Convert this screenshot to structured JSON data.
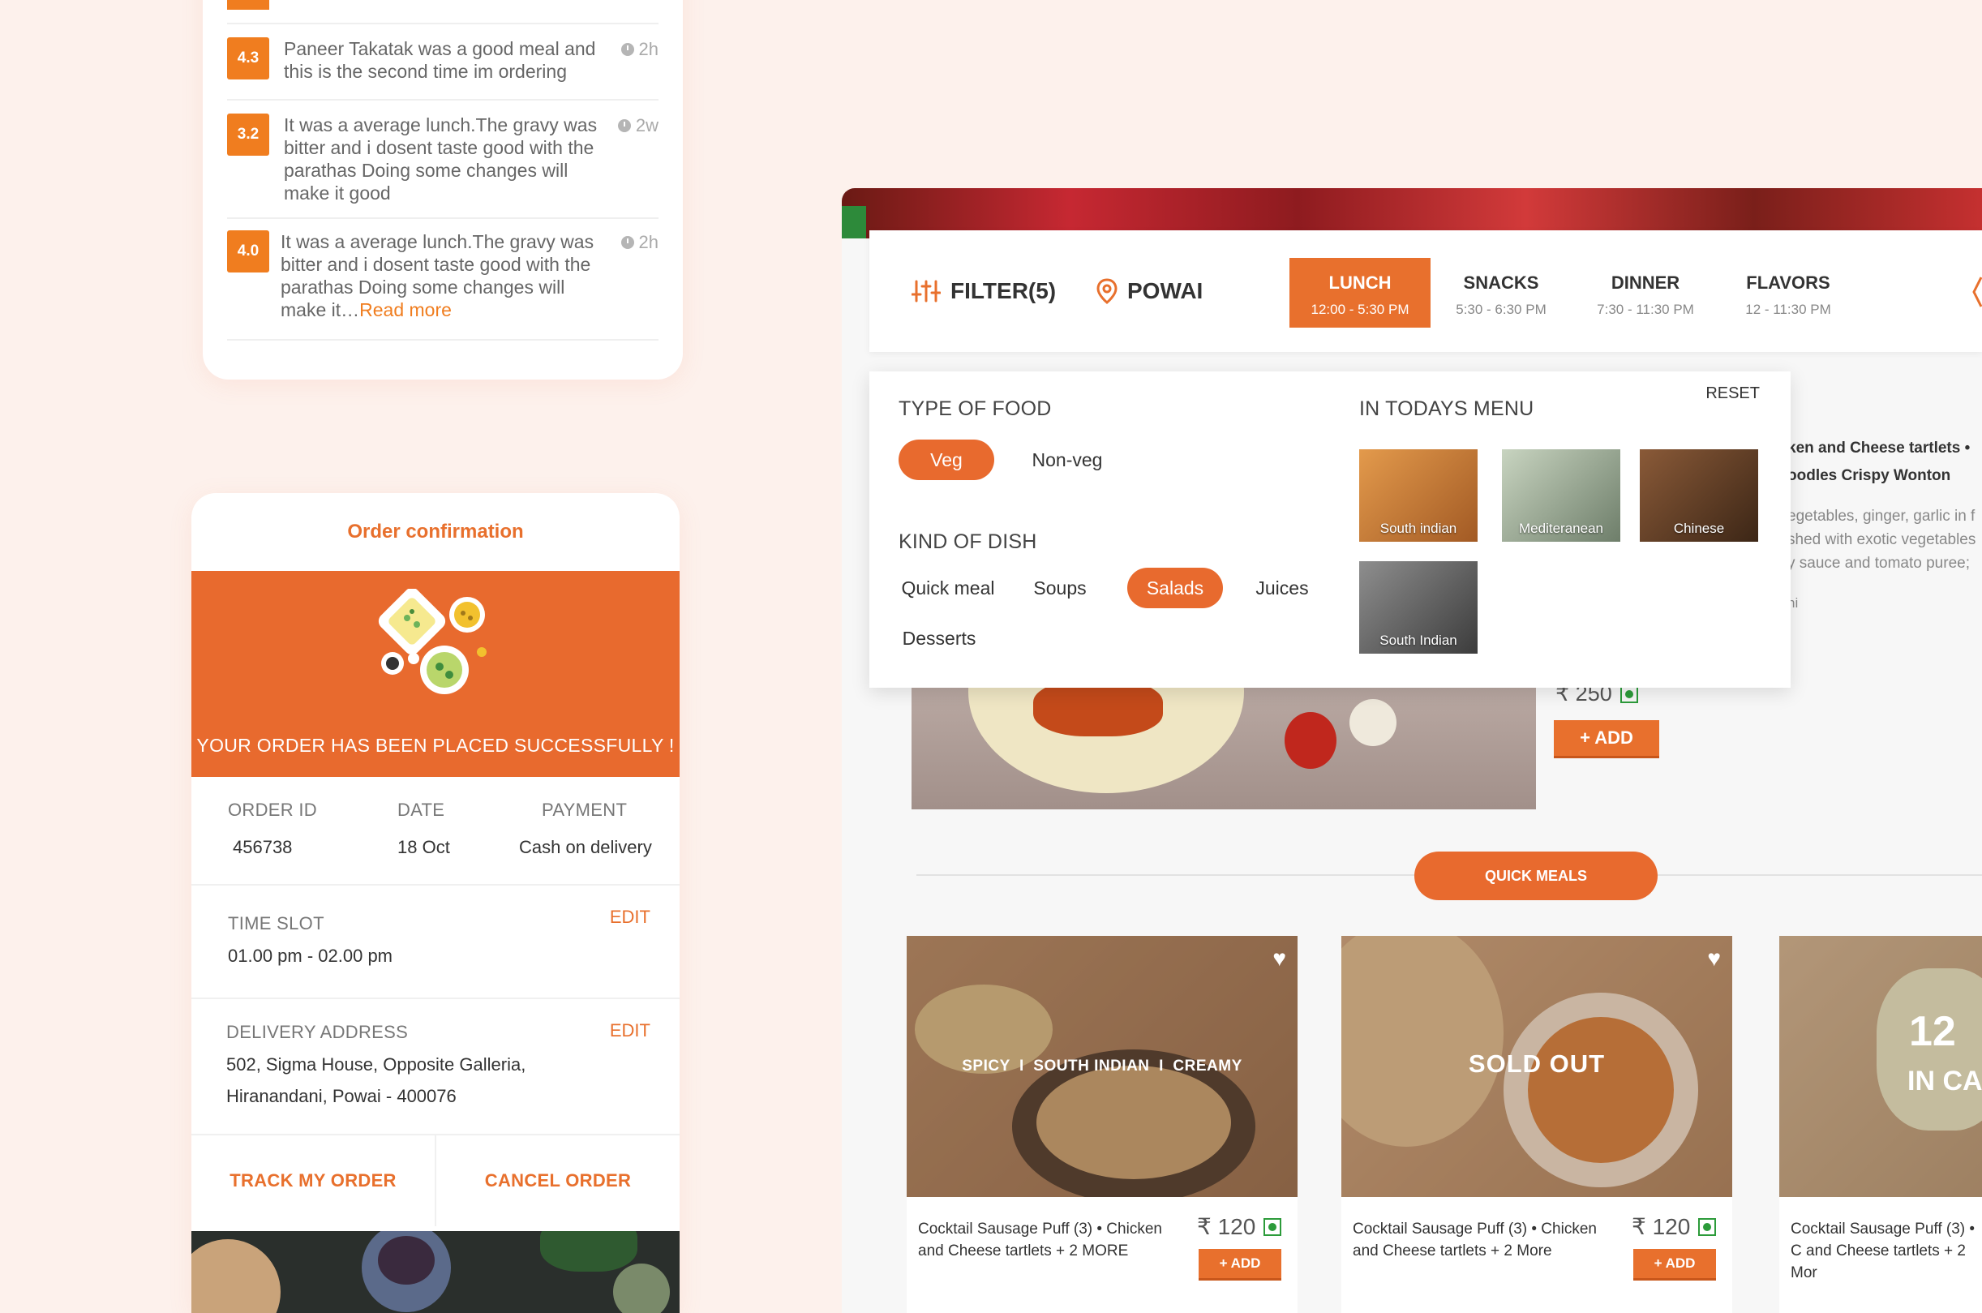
{
  "reviews": [
    {
      "rating": "4.3",
      "text": "Paneer Takatak was a good meal and this is the second time im ordering",
      "time": "2h"
    },
    {
      "rating": "3.2",
      "text": "It was a average lunch.The gravy was bitter and i dosent taste good with the parathas Doing some changes will make it good",
      "time": "2w"
    },
    {
      "rating": "4.0",
      "text": "It was a average lunch.The gravy was bitter and i dosent taste good with the parathas Doing some changes will make it…",
      "read_more": "Read more",
      "time": "2h"
    }
  ],
  "order": {
    "title": "Order confirmation",
    "success_message": "YOUR ORDER HAS BEEN PLACED SUCCESSFULLY !",
    "order_id_label": "ORDER ID",
    "order_id": "456738",
    "date_label": "DATE",
    "date": "18 Oct",
    "payment_label": "PAYMENT",
    "payment": "Cash on delivery",
    "time_slot_label": "TIME SLOT",
    "time_slot": "01.00 pm - 02.00 pm",
    "delivery_label": "DELIVERY ADDRESS",
    "address_line1": "502, Sigma House, Opposite Galleria,",
    "address_line2": "Hiranandani, Powai - 400076",
    "edit_label": "EDIT",
    "track_label": "TRACK MY ORDER",
    "cancel_label": "CANCEL ORDER"
  },
  "nav": {
    "filter_label": "FILTER(5)",
    "location": "POWAI",
    "tabs": [
      {
        "label": "LUNCH",
        "time": "12:00 - 5:30 PM"
      },
      {
        "label": "SNACKS",
        "time": "5:30 - 6:30 PM"
      },
      {
        "label": "DINNER",
        "time": "7:30 - 11:30 PM"
      },
      {
        "label": "FLAVORS",
        "time": "12 - 11:30 PM"
      }
    ]
  },
  "filter": {
    "type_heading": "TYPE OF FOOD",
    "types": [
      "Veg",
      "Non-veg"
    ],
    "dish_heading": "KIND OF DISH",
    "dishes": [
      "Quick meal",
      "Soups",
      "Salads",
      "Juices",
      "Desserts"
    ],
    "menu_heading": "IN TODAYS MENU",
    "reset_label": "RESET",
    "cuisines": [
      "South indian",
      "Mediteranean",
      "Chinese",
      "South Indian"
    ]
  },
  "featured": {
    "line1": "ken and Cheese tartlets •",
    "line2": "oodles Crispy Wonton",
    "desc1": "egetables, ginger, garlic in f",
    "desc2": "shed with exotic vegetables",
    "desc3": "y sauce and tomato puree;",
    "desc4": "ni",
    "price": "₹ 250",
    "add_label": "+ ADD"
  },
  "section_label": "QUICK MEALS",
  "meals": [
    {
      "overlay": "SPICY  I  SOUTH INDIAN  I  CREAMY",
      "name": "Cocktail Sausage Puff (3)  • Chicken and Cheese tartlets  + 2 MORE",
      "price": "₹ 120",
      "add": "+ ADD"
    },
    {
      "overlay": "SOLD OUT",
      "name": "Cocktail Sausage Puff (3)  • Chicken and Cheese tartlets  + 2 More",
      "price": "₹ 120",
      "add": "+ ADD"
    },
    {
      "overlay1": "12",
      "overlay2": "IN CA",
      "name": "Cocktail Sausage Puff (3)  • C and Cheese tartlets  + 2 Mor"
    }
  ]
}
